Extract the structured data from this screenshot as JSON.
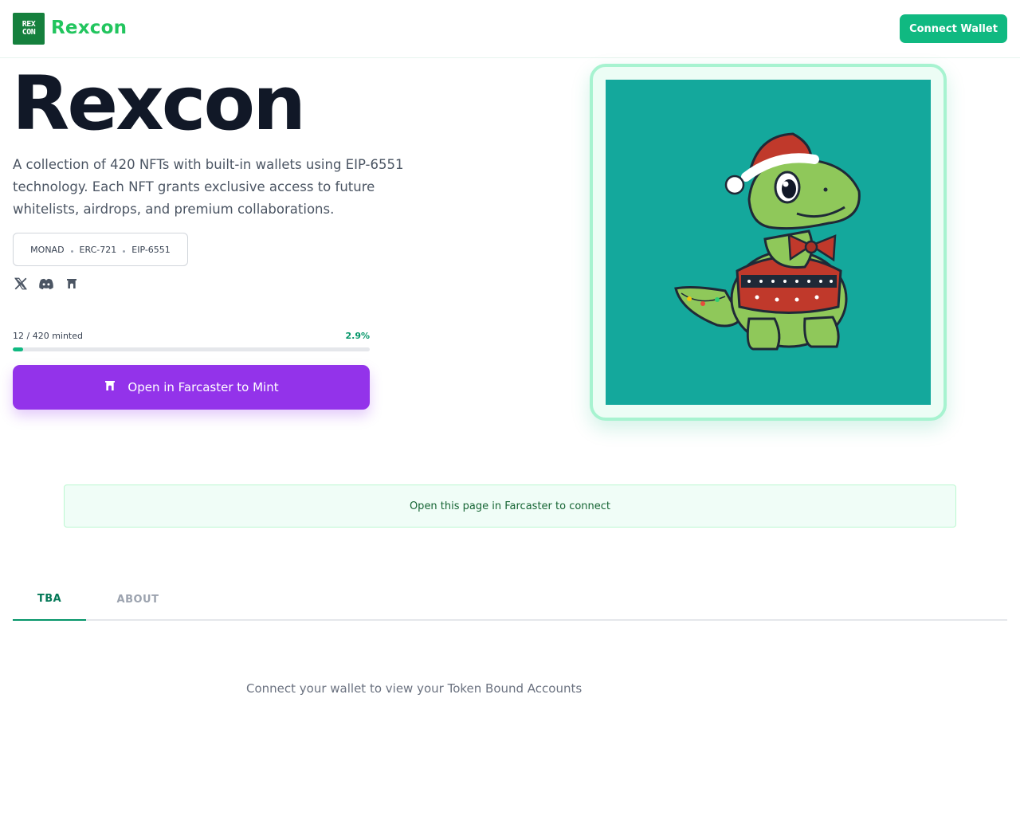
{
  "header": {
    "logo_top": "REX",
    "logo_bottom": "CON",
    "brand": "Rexcon",
    "connect_label": "Connect Wallet"
  },
  "hero": {
    "title": "Rexcon",
    "description": "A collection of 420 NFTs with built-in wallets using EIP-6551 technology. Each NFT grants exclusive access to future whitelists, airdrops, and premium collaborations.",
    "tags": [
      "MONAD",
      "ERC-721",
      "EIP-6551"
    ],
    "socials": [
      "x-icon",
      "discord-icon",
      "farcaster-icon"
    ]
  },
  "mint": {
    "minted_label": "12 / 420 minted",
    "percent_label": "2.9%",
    "progress_fraction": 0.029,
    "button_label": "Open in Farcaster to Mint"
  },
  "notice": {
    "text": "Open this page in Farcaster to connect"
  },
  "tabs": [
    {
      "label": "TBA",
      "active": true
    },
    {
      "label": "ABOUT",
      "active": false
    }
  ],
  "tba": {
    "empty_message": "Connect your wallet to view your Token Bound Accounts"
  },
  "colors": {
    "accent": "#10b981",
    "brand_text": "#22c55e",
    "farcaster": "#9333ea",
    "nft_background": "#14a89c"
  }
}
